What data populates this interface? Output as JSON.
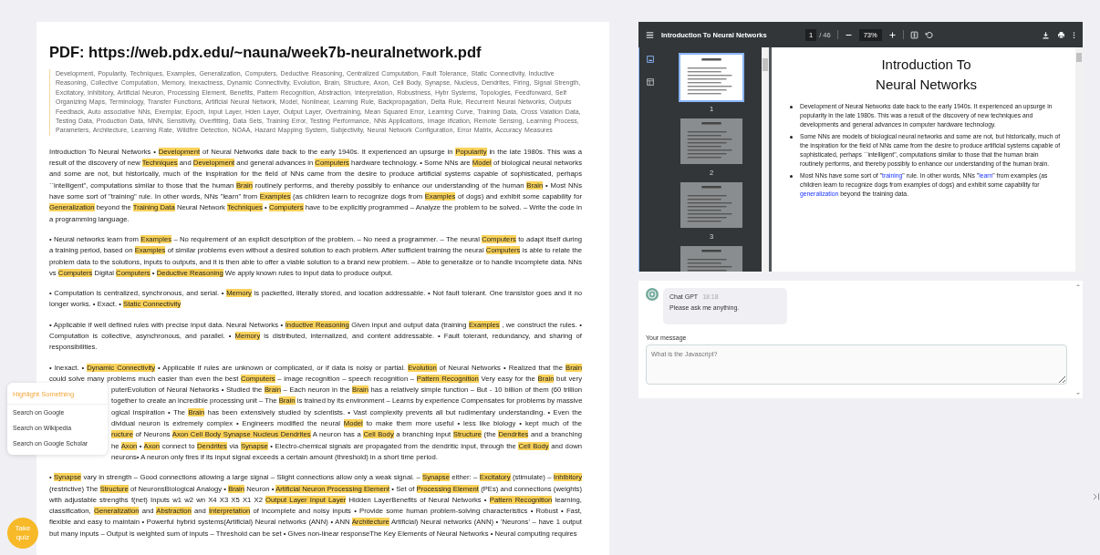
{
  "page_title": "PDF: https://web.pdx.edu/~nauna/week7b-neuralnetwork.pdf",
  "keywords": "Development,  Popularity,  Techniques,  Examples,  Generalization,  Computers,  Deductive Reasoning,  Centralized Computation,  Fault Tolerance,  Static Connectivity,  Inductive Reasoning,  Collective Computation,  Memory,  Inexactness,  Dynamic Connectivity,  Evolution,  Brain,  Structure,  Axon,  Cell Body,  Synapse,  Nucleus,  Dendrites,  Firing,  Signal Strength,  Excitatory,  Inhibitory,  Artificial Neuron,  Processing Element,  Benefits,  Pattern Recognition,  Abstraction,  Interpretation,  Robustness,  Hybr Systems,  Topologies,  Feedforward,  Self Organizing Maps,  Terminology,  Transfer Functions,  Artificial Neural Network,  Model,  Nonlinear,  Learning Rule,  Backpropagation,  Delta Rule,  Recurrent Neural Networks,  Outputs Feedback,  Auto associative NNs,  Exemplar,  Epoch,  Input Layer,  Hden Layer,  Output Layer,  Overtraining,  Mean Squared Error,  Learning Curve,  Training Data,  Cross Valation Data,  Testing Data,  Production Data,  MNN,  Sensitivity,  Overfitting,  Data Sets,  Training Error,  Testing Performance,  NNs Applications,  Image ification,  Remote Sensing,  Learning Process,  Parameters,  Architecture,  Learning Rate,  Wildfire Detection,  NOAA,  Hazard Mapping System,  Subjectivity,  Neural Network Configuration,  Error Matrix,  Accuracy Measures",
  "paragraphs": [
    {
      "kind": "flow",
      "segments": [
        {
          "text": "Introduction To Neural Networks • ",
          "highlighted": false
        },
        {
          "text": "Development",
          "highlighted": true
        },
        {
          "text": " of Neural Networks date back to the early 1940s. It experienced an upsurge in ",
          "highlighted": false
        },
        {
          "text": "Popularity",
          "highlighted": true
        },
        {
          "text": " in the late 1980s. This was a result of the discovery of new ",
          "highlighted": false
        },
        {
          "text": "Techniques",
          "highlighted": true
        },
        {
          "text": " and ",
          "highlighted": false
        },
        {
          "text": "Development",
          "highlighted": true
        },
        {
          "text": " and general advances in ",
          "highlighted": false
        },
        {
          "text": "Computers",
          "highlighted": true
        },
        {
          "text": " hardware technology. • Some NNs are ",
          "highlighted": false
        },
        {
          "text": "Model",
          "highlighted": true
        },
        {
          "text": " of biological neural networks and some are not, but historically, much of the inspiration for the field of NNs came from the desire to produce artificial systems capable of sophisticated, perhaps ``intelligent\", computations similar to those that the human ",
          "highlighted": false
        },
        {
          "text": "Brain",
          "highlighted": true
        },
        {
          "text": " routinely performs, and thereby possibly to enhance our understanding of the human ",
          "highlighted": false
        },
        {
          "text": "Brain",
          "highlighted": true
        },
        {
          "text": " • Most NNs have some sort of \"training\" rule. In other words, NNs \"learn\" from ",
          "highlighted": false
        },
        {
          "text": "Examples",
          "highlighted": true
        },
        {
          "text": " (as children learn to recognize dogs from ",
          "highlighted": false
        },
        {
          "text": "Examples",
          "highlighted": true
        },
        {
          "text": " of dogs) and exhibit some capability for ",
          "highlighted": false
        },
        {
          "text": "Generalization",
          "highlighted": true
        },
        {
          "text": " beyond the ",
          "highlighted": false
        },
        {
          "text": "Training Data",
          "highlighted": true
        },
        {
          "text": " Neural Network ",
          "highlighted": false
        },
        {
          "text": "Techniques",
          "highlighted": true
        },
        {
          "text": " • ",
          "highlighted": false
        },
        {
          "text": "Computers",
          "highlighted": true
        },
        {
          "text": " have to be explicitly programmed – Analyze the problem to be solved. – Write the code in a programming language.",
          "highlighted": false
        }
      ]
    },
    {
      "kind": "flow",
      "segments": [
        {
          "text": "• Neural networks learn from ",
          "highlighted": false
        },
        {
          "text": "Examples",
          "highlighted": true
        },
        {
          "text": " – No requirement of an explicit description of the problem. – No need a programmer. – The neural ",
          "highlighted": false
        },
        {
          "text": "Computers",
          "highlighted": true
        },
        {
          "text": " to adapt itself during a training period, based on ",
          "highlighted": false
        },
        {
          "text": "Examples",
          "highlighted": true
        },
        {
          "text": " of similar problems even without a desired solution to each problem. After sufficient training the neural ",
          "highlighted": false
        },
        {
          "text": "Computers",
          "highlighted": true
        },
        {
          "text": " is able to relate the problem data to the solutions, inputs to outputs, and it is then able to offer a viable solution to a brand new problem. – Able to generalize or to handle incomplete data. NNs vs ",
          "highlighted": false
        },
        {
          "text": "Computers",
          "highlighted": true
        },
        {
          "text": " Digital ",
          "highlighted": false
        },
        {
          "text": "Computers",
          "highlighted": true
        },
        {
          "text": " • ",
          "highlighted": false
        },
        {
          "text": "Deductive Reasoning",
          "highlighted": true
        },
        {
          "text": " We apply known rules to input data to produce output.",
          "highlighted": false
        }
      ]
    },
    {
      "kind": "flow",
      "segments": [
        {
          "text": "• Computation is centralized, synchronous, and serial. • ",
          "highlighted": false
        },
        {
          "text": "Memory",
          "highlighted": true
        },
        {
          "text": " is packetted, literally stored, and location addressable. • Not fault tolerant. One transistor goes and it no longer works. • Exact. • ",
          "highlighted": false
        },
        {
          "text": "Static Connectivity",
          "highlighted": true
        }
      ]
    },
    {
      "kind": "flow",
      "segments": [
        {
          "text": "• Applicable if well defined rules with precise input data. Neural Networks • ",
          "highlighted": false
        },
        {
          "text": "Inductive Reasoning",
          "highlighted": true
        },
        {
          "text": " Given input and output data (training ",
          "highlighted": false
        },
        {
          "text": "Examples",
          "highlighted": true
        },
        {
          "text": " , we construct the rules. • Computation is collective, asynchronous, and parallel. • ",
          "highlighted": false
        },
        {
          "text": "Memory",
          "highlighted": true
        },
        {
          "text": " is distributed, internalized, and content addressable. • Fault tolerant, redundancy, and sharing of responsibilities.",
          "highlighted": false
        }
      ]
    },
    {
      "kind": "lines",
      "lines": [
        {
          "covered": false,
          "segments": [
            {
              "text": "• Inexact. • ",
              "highlighted": false
            },
            {
              "text": "Dynamic Connectivity",
              "highlighted": true
            },
            {
              "text": " • Applicable if rules are unknown or complicated, or if data is noisy or partial. ",
              "highlighted": false
            },
            {
              "text": "Evolution",
              "highlighted": true
            },
            {
              "text": " of Neural Networks • Realized that the ",
              "highlighted": false
            },
            {
              "text": "Brain",
              "highlighted": true
            }
          ]
        },
        {
          "covered": false,
          "segments": [
            {
              "text": "could solve many problems much easier than even the best ",
              "highlighted": false
            },
            {
              "text": "Computers",
              "highlighted": true
            },
            {
              "text": " – image recognition – speech recognition – ",
              "highlighted": false
            },
            {
              "text": "Pattern Recognition",
              "highlighted": true
            },
            {
              "text": " Very easy for the ",
              "highlighted": false
            },
            {
              "text": "Brain",
              "highlighted": true
            },
            {
              "text": " but very",
              "highlighted": false
            }
          ]
        },
        {
          "covered": true,
          "segments": [
            {
              "text": "puterEvolution of Neural Networks • Studied the ",
              "highlighted": false
            },
            {
              "text": "Brain",
              "highlighted": true
            },
            {
              "text": " – Each neuron in the ",
              "highlighted": false
            },
            {
              "text": "Brain",
              "highlighted": true
            },
            {
              "text": " has a relatively simple function – But - 10 billion of them (60 trillion",
              "highlighted": false
            }
          ]
        },
        {
          "covered": true,
          "segments": [
            {
              "text": "together to create an incredible processing unit – The ",
              "highlighted": false
            },
            {
              "text": "Brain",
              "highlighted": true
            },
            {
              "text": " is trained by its environment – Learns by experience Compensates for problems by massive",
              "highlighted": false
            }
          ]
        },
        {
          "covered": true,
          "segments": [
            {
              "text": "ogical Inspiration • The ",
              "highlighted": false
            },
            {
              "text": "Brain",
              "highlighted": true
            },
            {
              "text": " has been extensively studied by scientists. • Vast complexity prevents all but rudimentary understanding. • Even the",
              "highlighted": false
            }
          ]
        },
        {
          "covered": true,
          "segments": [
            {
              "text": "dividual neuron is extremely complex • Engineers modified the neural ",
              "highlighted": false
            },
            {
              "text": "Model",
              "highlighted": true
            },
            {
              "text": " to make them more useful • less like biology • kept much of the",
              "highlighted": false
            }
          ]
        },
        {
          "covered": true,
          "segments": [
            {
              "text": "ructure",
              "highlighted": true
            },
            {
              "text": " of Neurons ",
              "highlighted": false
            },
            {
              "text": "Axon ",
              "highlighted": true
            },
            {
              "text": "Cell Body ",
              "highlighted": true
            },
            {
              "text": "Synapse ",
              "highlighted": true
            },
            {
              "text": "Nucleus ",
              "highlighted": true
            },
            {
              "text": "Dendrites",
              "highlighted": true
            },
            {
              "text": " A neuron has a ",
              "highlighted": false
            },
            {
              "text": "Cell Body",
              "highlighted": true
            },
            {
              "text": " a branching input ",
              "highlighted": false
            },
            {
              "text": "Structure",
              "highlighted": true
            },
            {
              "text": " (the ",
              "highlighted": false
            },
            {
              "text": "Dendrites",
              "highlighted": true
            },
            {
              "text": " and a branching",
              "highlighted": false
            }
          ]
        },
        {
          "covered": true,
          "segments": [
            {
              "text": "he ",
              "highlighted": false
            },
            {
              "text": "Axon",
              "highlighted": true
            },
            {
              "text": " • ",
              "highlighted": false
            },
            {
              "text": "Axon",
              "highlighted": true
            },
            {
              "text": " connect to ",
              "highlighted": false
            },
            {
              "text": "Dendrites",
              "highlighted": true
            },
            {
              "text": " via ",
              "highlighted": false
            },
            {
              "text": "Synapse",
              "highlighted": true
            },
            {
              "text": " • Electro-chemical signals are propagated from the dendritic input, through the ",
              "highlighted": false
            },
            {
              "text": "Cell Body",
              "highlighted": true
            },
            {
              "text": " and down",
              "highlighted": false
            }
          ]
        },
        {
          "covered": true,
          "segments": [
            {
              "text": "neurons• A neuron only fires if its input signal exceeds a certain amount (threshold) in a short time period.",
              "highlighted": false
            }
          ]
        }
      ]
    },
    {
      "kind": "flow",
      "segments": [
        {
          "text": "• ",
          "highlighted": false
        },
        {
          "text": "Synapse",
          "highlighted": true
        },
        {
          "text": " vary in strength – Good connections allowing a large signal – Slight connections allow only a weak signal. – ",
          "highlighted": false
        },
        {
          "text": "Synapse",
          "highlighted": true
        },
        {
          "text": " either: – ",
          "highlighted": false
        },
        {
          "text": "Excitatory",
          "highlighted": true
        },
        {
          "text": " (stimulate) – ",
          "highlighted": false
        },
        {
          "text": "Inhibitory",
          "highlighted": true
        },
        {
          "text": " (restrictive) The ",
          "highlighted": false
        },
        {
          "text": "Structure",
          "highlighted": true
        },
        {
          "text": " of NeuronsBiological Analogy • ",
          "highlighted": false
        },
        {
          "text": "Brain",
          "highlighted": true
        },
        {
          "text": " Neuron • ",
          "highlighted": false
        },
        {
          "text": "Artificial Neuron ",
          "highlighted": true
        },
        {
          "text": "Processing Element",
          "highlighted": true
        },
        {
          "text": " • Set of ",
          "highlighted": false
        },
        {
          "text": "Processing Element",
          "highlighted": true
        },
        {
          "text": " (PEs) and connections (weights) with adjustable strengths f(net) Inputs w1 w2 wn X4 X3 X5 X1 X2 ",
          "highlighted": false
        },
        {
          "text": "Output Layer ",
          "highlighted": true
        },
        {
          "text": "Input Layer",
          "highlighted": true
        },
        {
          "text": " Hidden LayerBenefits of Neural Networks • ",
          "highlighted": false
        },
        {
          "text": "Pattern Recognition",
          "highlighted": true
        },
        {
          "text": " learning, classification, ",
          "highlighted": false
        },
        {
          "text": "Generalization",
          "highlighted": true
        },
        {
          "text": " and ",
          "highlighted": false
        },
        {
          "text": "Abstraction",
          "highlighted": true
        },
        {
          "text": " and ",
          "highlighted": false
        },
        {
          "text": "Interpretation",
          "highlighted": true
        },
        {
          "text": " of incomplete and noisy inputs • Provide some human problem-solving characteristics • Robust • Fast, flexible and easy to maintain • Powerful hybrid systems(Artificial) Neural networks (ANN) • ANN ",
          "highlighted": false
        },
        {
          "text": "Architecture",
          "highlighted": true
        },
        {
          "text": " Artificial) Neural networks (ANN) • 'Neurons' – have 1 output but many inputs – Output is weighted sum of inputs – Threshold can be set • Gives non-linear responseThe Key Elements of Neural Networks • Neural computing requires",
          "highlighted": false
        }
      ]
    }
  ],
  "context_menu": {
    "title": "Highlight Something",
    "items": [
      "Search on Google",
      "Search on Wikipedia",
      "Search on Google Scholar"
    ]
  },
  "quiz_button": "Take quiz",
  "pdf_viewer": {
    "title": "Introduction To Neural Networks",
    "page": "1",
    "page_count": "/ 46",
    "zoom": "73%",
    "thumbnails": [
      {
        "label": "1",
        "selected": true
      },
      {
        "label": "2",
        "selected": false
      },
      {
        "label": "3",
        "selected": false
      },
      {
        "selected": false
      }
    ],
    "page_heading": "Introduction To Neural Networks",
    "bullets": [
      [
        {
          "text": "Development of Neural Networks date back to the early 1940s. It experienced an upsurge in popularity in the late 1980s. This was a result of the discovery of new techniques and developments and general advances in computer hardware technology.",
          "accent": false
        }
      ],
      [
        {
          "text": "Some NNs are models of biological neural networks and some are not, but historically, much of the inspiration for the field of NNs came from the desire to produce artificial systems capable of sophisticated, perhaps ``intelligent\", computations similar to those that the human brain routinely performs, and thereby possibly to enhance our understanding of the human brain.",
          "accent": false
        }
      ],
      [
        {
          "text": "Most NNs have some sort of \"",
          "accent": false
        },
        {
          "text": "training",
          "accent": true
        },
        {
          "text": "\" rule. In other words, NNs \"",
          "accent": false
        },
        {
          "text": "learn",
          "accent": true
        },
        {
          "text": "\" from examples (as children learn to recognize dogs from examples of dogs) and exhibit some capability for ",
          "accent": false
        },
        {
          "text": "generalization",
          "accent": true
        },
        {
          "text": " beyond the training data.",
          "accent": false
        }
      ]
    ]
  },
  "chat": {
    "sender": "Chat GPT",
    "time": "18:18",
    "message": "Please ask me anything.",
    "input_label": "Your message",
    "placeholder": "What is the Javascript?"
  }
}
